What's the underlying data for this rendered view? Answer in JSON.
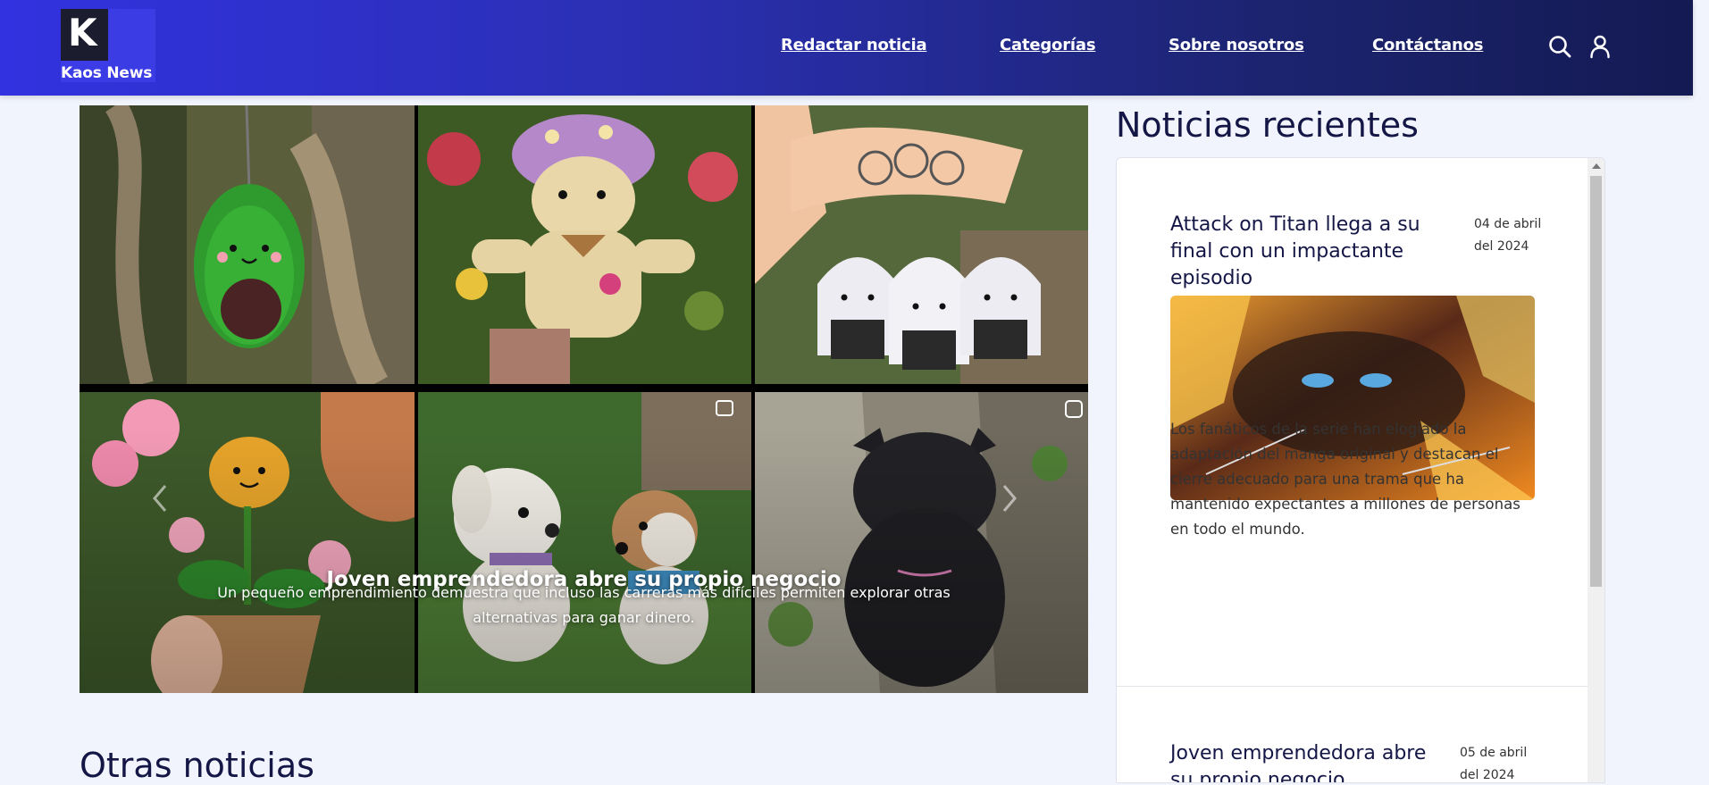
{
  "header": {
    "brand": {
      "logo_letter": "K",
      "name": "Kaos News"
    },
    "nav": [
      {
        "label": "Redactar noticia"
      },
      {
        "label": "Categorías"
      },
      {
        "label": "Sobre nosotros"
      },
      {
        "label": "Contáctanos"
      }
    ],
    "icons": {
      "search": "search-icon",
      "user": "user-icon"
    }
  },
  "hero": {
    "title": "Joven emprendedora abre su propio negocio",
    "subtitle": "Un pequeño emprendimiento demuestra que incluso las carreras más difíciles permiten explorar otras alternativas para ganar dinero.",
    "tiles": [
      "avocado-keychain",
      "mushroom-bear-doll",
      "onigiri-keychains",
      "potted-flower-doll",
      "dog-dolls",
      "black-cat-doll"
    ]
  },
  "recent": {
    "title": "Noticias recientes",
    "items": [
      {
        "title": "Attack on Titan llega a su final con un impactante episodio",
        "date": "04 de abril del 2024",
        "description": "Los fanáticos de la serie han elogiado la adaptación del manga original y destacan el cierre adecuado para una trama que ha mantenido expectantes a millones de personas en todo el mundo."
      },
      {
        "title": "Joven emprendedora abre su propio negocio",
        "date": "05 de abril del 2024"
      }
    ]
  },
  "other": {
    "title": "Otras noticias"
  },
  "colors": {
    "header_start": "#3232e0",
    "header_end": "#141a52",
    "text_dark": "#141646",
    "page_bg": "#f1f4fc"
  }
}
